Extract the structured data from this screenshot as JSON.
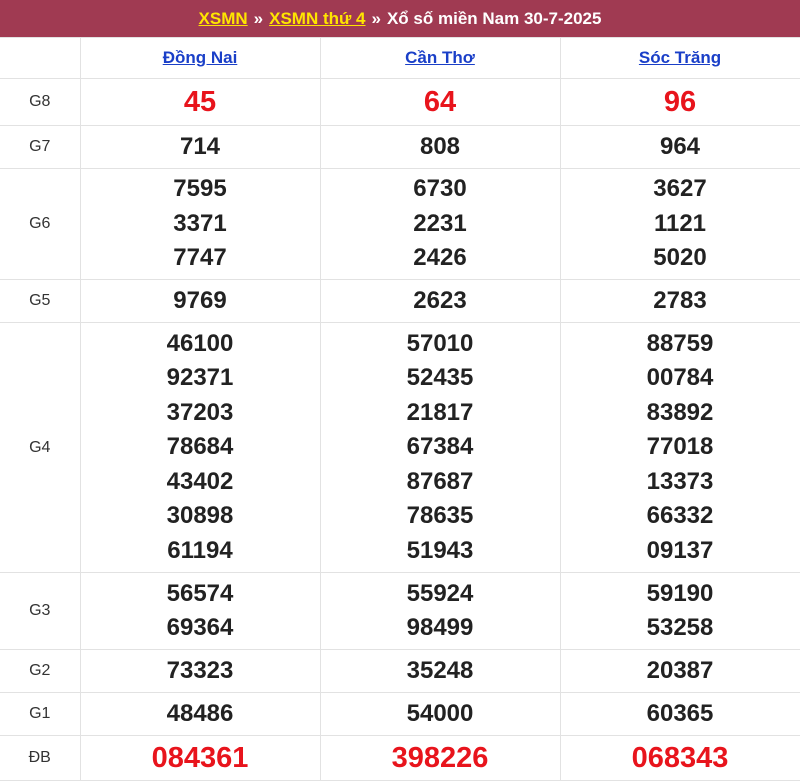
{
  "header": {
    "link1": "XSMN",
    "sep": "»",
    "link2": "XSMN thứ 4",
    "title": "Xổ số miền Nam 30-7-2025"
  },
  "provinces": [
    "Đồng Nai",
    "Cần Thơ",
    "Sóc Trăng"
  ],
  "prizes": [
    {
      "label": "G8",
      "key": "g8",
      "red": true,
      "values": [
        [
          "45"
        ],
        [
          "64"
        ],
        [
          "96"
        ]
      ]
    },
    {
      "label": "G7",
      "key": "g7",
      "red": false,
      "values": [
        [
          "714"
        ],
        [
          "808"
        ],
        [
          "964"
        ]
      ]
    },
    {
      "label": "G6",
      "key": "g6",
      "red": false,
      "values": [
        [
          "7595",
          "3371",
          "7747"
        ],
        [
          "6730",
          "2231",
          "2426"
        ],
        [
          "3627",
          "1121",
          "5020"
        ]
      ]
    },
    {
      "label": "G5",
      "key": "g5",
      "red": false,
      "values": [
        [
          "9769"
        ],
        [
          "2623"
        ],
        [
          "2783"
        ]
      ]
    },
    {
      "label": "G4",
      "key": "g4",
      "red": false,
      "values": [
        [
          "46100",
          "92371",
          "37203",
          "78684",
          "43402",
          "30898",
          "61194"
        ],
        [
          "57010",
          "52435",
          "21817",
          "67384",
          "87687",
          "78635",
          "51943"
        ],
        [
          "88759",
          "00784",
          "83892",
          "77018",
          "13373",
          "66332",
          "09137"
        ]
      ]
    },
    {
      "label": "G3",
      "key": "g3",
      "red": false,
      "values": [
        [
          "56574",
          "69364"
        ],
        [
          "55924",
          "98499"
        ],
        [
          "59190",
          "53258"
        ]
      ]
    },
    {
      "label": "G2",
      "key": "g2",
      "red": false,
      "values": [
        [
          "73323"
        ],
        [
          "35248"
        ],
        [
          "20387"
        ]
      ]
    },
    {
      "label": "G1",
      "key": "g1",
      "red": false,
      "values": [
        [
          "48486"
        ],
        [
          "54000"
        ],
        [
          "60365"
        ]
      ]
    },
    {
      "label": "ĐB",
      "key": "db",
      "red": true,
      "values": [
        [
          "084361"
        ],
        [
          "398226"
        ],
        [
          "068343"
        ]
      ]
    }
  ]
}
